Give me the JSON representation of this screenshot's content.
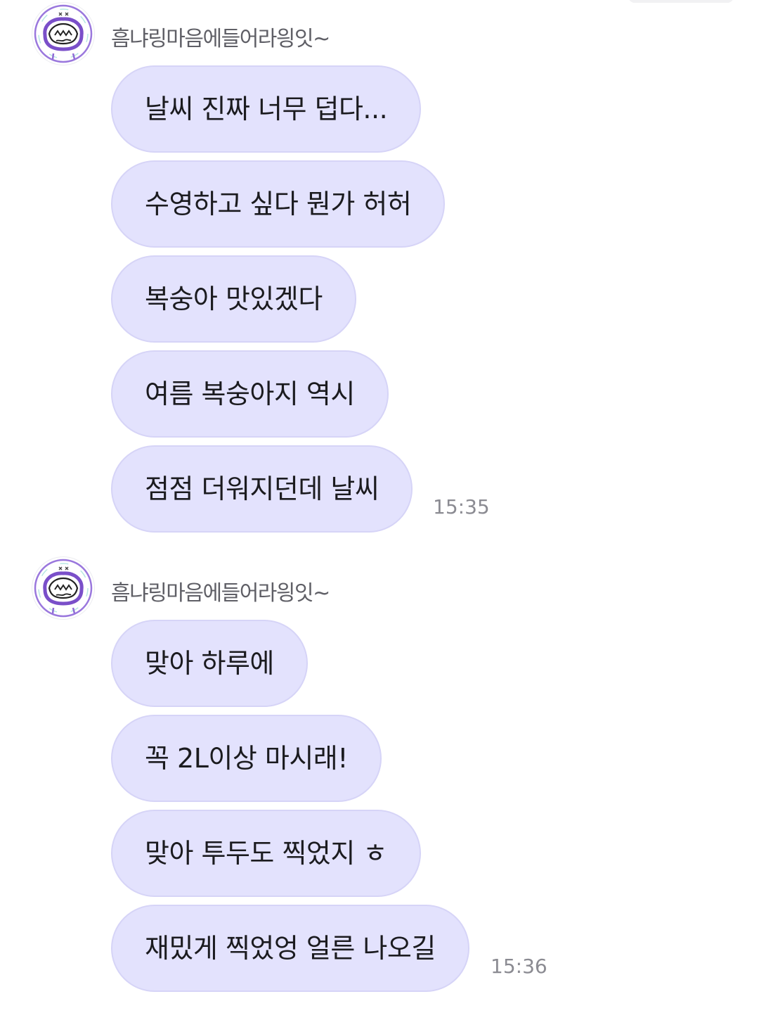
{
  "groups": [
    {
      "sender": "흠냐링마음에들어라읭잇~",
      "avatar_icon": "bread-bun-avatar-icon",
      "messages": [
        {
          "text": "날씨 진짜 너무 덥다..."
        },
        {
          "text": "수영하고 싶다 뭔가 허허"
        },
        {
          "text": "복숭아 맛있겠다"
        },
        {
          "text": "여름 복숭아지 역시"
        },
        {
          "text": "점점 더워지던데 날씨"
        }
      ],
      "time": "15:35"
    },
    {
      "sender": "흠냐링마음에들어라읭잇~",
      "avatar_icon": "bread-bun-avatar-icon",
      "messages": [
        {
          "text": "맞아 하루에"
        },
        {
          "text": "꼭 2L이상 마시래!"
        },
        {
          "text": "맞아 투두도 찍었지 ㅎ"
        },
        {
          "text": "재밌게 찍었엉 얼른 나오길"
        }
      ],
      "time": "15:36"
    }
  ],
  "colors": {
    "bubble_fill": "#e3e2fd",
    "bubble_border": "#d6d4f7",
    "avatar_ring": "#8f6bd6"
  }
}
